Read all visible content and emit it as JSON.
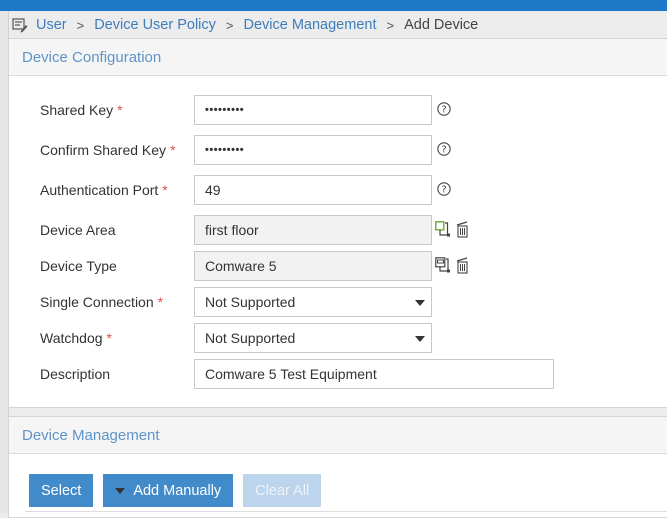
{
  "breadcrumb": {
    "icon": "edit-list-icon",
    "items": [
      {
        "label": "User",
        "link": true
      },
      {
        "label": "Device User Policy",
        "link": true
      },
      {
        "label": "Device Management",
        "link": true
      },
      {
        "label": "Add Device",
        "link": false
      }
    ],
    "separator": ">"
  },
  "device_configuration": {
    "title": "Device Configuration",
    "fields": {
      "shared_key": {
        "label": "Shared Key",
        "required": "*",
        "value": "•••••••••",
        "help_icon": "help-icon"
      },
      "confirm_shared_key": {
        "label": "Confirm Shared Key",
        "required": "*",
        "value": "•••••••••",
        "help_icon": "help-icon"
      },
      "auth_port": {
        "label": "Authentication Port",
        "required": "*",
        "value": "49",
        "help_icon": "help-icon"
      },
      "device_area": {
        "label": "Device Area",
        "value": "first floor",
        "icons": [
          "select-area-icon",
          "delete-icon"
        ]
      },
      "device_type": {
        "label": "Device Type",
        "value": "Comware 5",
        "icons": [
          "select-type-icon",
          "delete-icon"
        ]
      },
      "single_connection": {
        "label": "Single Connection",
        "required": "*",
        "value": "Not Supported"
      },
      "watchdog": {
        "label": "Watchdog",
        "required": "*",
        "value": "Not Supported"
      },
      "description": {
        "label": "Description",
        "value": "Comware 5 Test Equipment"
      }
    }
  },
  "device_management": {
    "title": "Device Management",
    "buttons": {
      "select": "Select",
      "add_manually": "Add Manually",
      "clear_all": "Clear All"
    }
  },
  "colors": {
    "topbar": "#1e78c8",
    "link": "#3e7dba",
    "panel_title": "#5f94c8",
    "primary_button": "#428bca",
    "disabled_button": "#bcd4ec",
    "required": "#d9534f"
  }
}
